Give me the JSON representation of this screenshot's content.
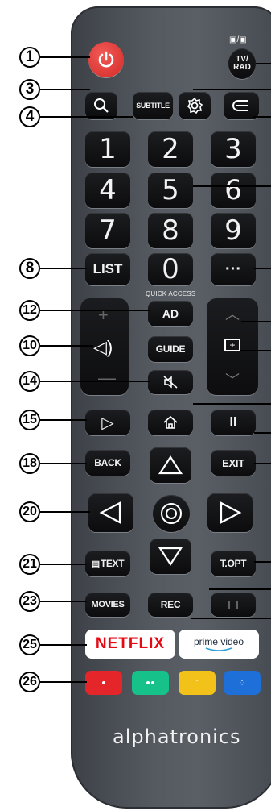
{
  "callouts": [
    "1",
    "3",
    "4",
    "8",
    "12",
    "10",
    "14",
    "15",
    "18",
    "20",
    "21",
    "23",
    "25",
    "26"
  ],
  "buttons": {
    "power_icon": "power-icon",
    "tv_rad": "TV/\nRAD",
    "tv_rad_icons": "📺/📻",
    "subtitle": "SUBTITLE",
    "num1": "1",
    "num2": "2",
    "num3": "3",
    "num4": "4",
    "num5": "5",
    "num6": "6",
    "num7": "7",
    "num8": "8",
    "num9": "9",
    "list": "LIST",
    "num0": "0",
    "more": "···",
    "quick_access": "QUICK ACCESS",
    "ad": "AD",
    "guide": "GUIDE",
    "play": "▷",
    "home": "⌂",
    "pause": "II",
    "back": "BACK",
    "exit": "EXIT",
    "text": "TEXT",
    "topt": "T.OPT",
    "movies": "MOVIES",
    "rec": "REC",
    "stop": "□"
  },
  "apps": {
    "netflix": "NETFLIX",
    "prime": "prime video"
  },
  "colors": {
    "red": "#e4262b",
    "green": "#17c28a",
    "yellow": "#f2c21a",
    "blue": "#1e6fd8"
  },
  "brand": "alphatronics"
}
